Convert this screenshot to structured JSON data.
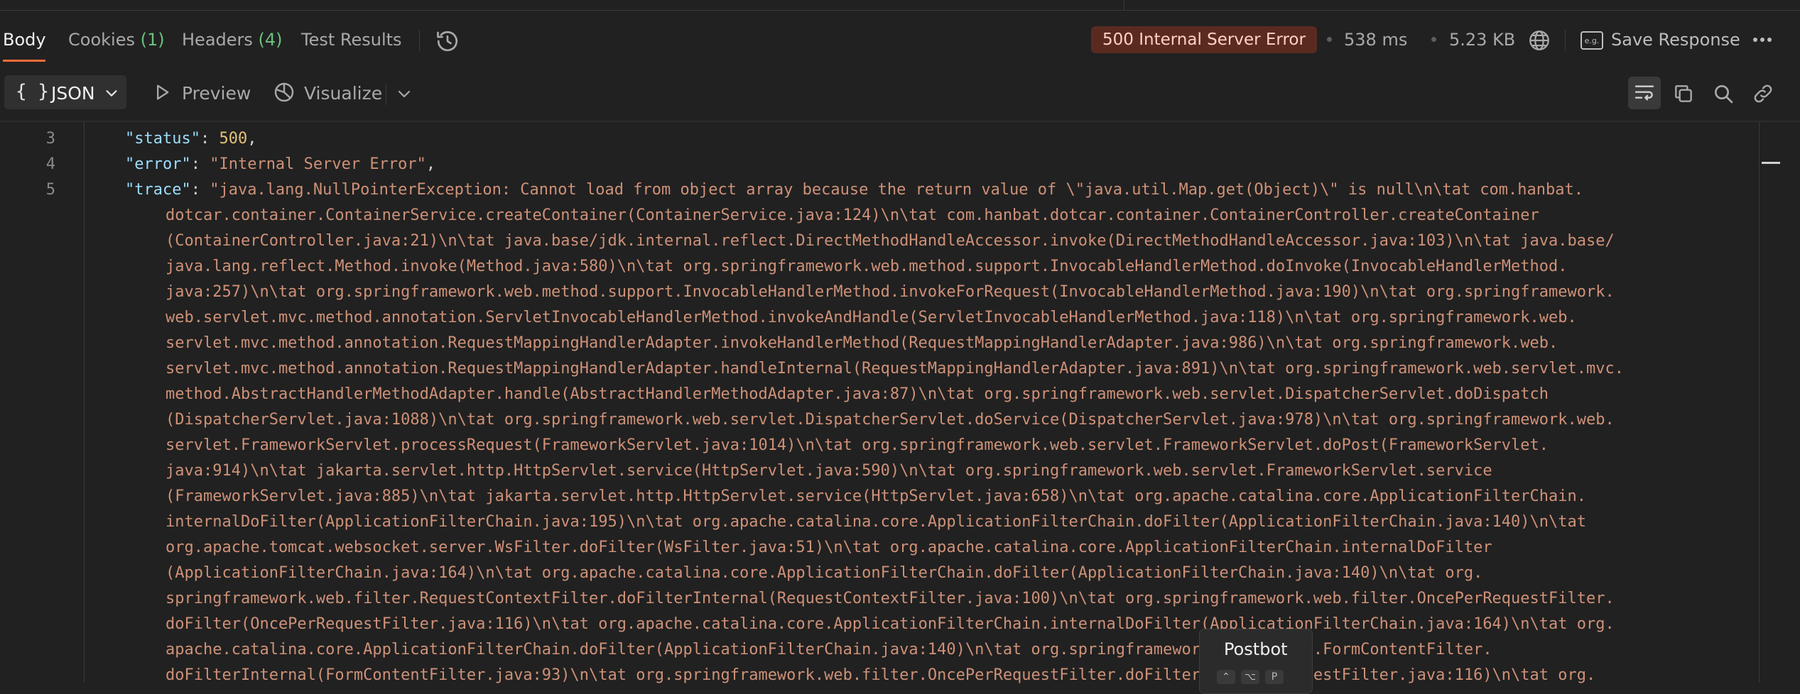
{
  "tabs": [
    {
      "label": "Body",
      "count": ""
    },
    {
      "label": "Cookies",
      "count": "(1)"
    },
    {
      "label": "Headers",
      "count": "(4)"
    },
    {
      "label": "Test Results",
      "count": ""
    }
  ],
  "response_meta": {
    "status": "500 Internal Server Error",
    "time": "538 ms",
    "size": "5.23 KB",
    "save_label": "Save Response",
    "eg_icon_text": "e.g."
  },
  "toolbar": {
    "format_braces": "{ }",
    "format_label": "JSON",
    "preview_label": "Preview",
    "visualize_label": "Visualize"
  },
  "code": {
    "lines": [
      {
        "number": "3",
        "key": "\"status\"",
        "value": "500",
        "trail": ","
      },
      {
        "number": "4",
        "key": "\"error\"",
        "value": "\"Internal Server Error\"",
        "trail": ","
      },
      {
        "number": "5",
        "key": "\"trace\"",
        "value": "\"java.lang.NullPointerException: Cannot load from object array because the return value of \\\"java.util.Map.get(Object)\\\" is null\\n\\tat com.hanbat.",
        "trail": ""
      }
    ],
    "trace_continuation": [
      "dotcar.container.ContainerService.createContainer(ContainerService.java:124)\\n\\tat com.hanbat.dotcar.container.ContainerController.createContainer",
      "(ContainerController.java:21)\\n\\tat java.base/jdk.internal.reflect.DirectMethodHandleAccessor.invoke(DirectMethodHandleAccessor.java:103)\\n\\tat java.base/",
      "java.lang.reflect.Method.invoke(Method.java:580)\\n\\tat org.springframework.web.method.support.InvocableHandlerMethod.doInvoke(InvocableHandlerMethod.",
      "java:257)\\n\\tat org.springframework.web.method.support.InvocableHandlerMethod.invokeForRequest(InvocableHandlerMethod.java:190)\\n\\tat org.springframework.",
      "web.servlet.mvc.method.annotation.ServletInvocableHandlerMethod.invokeAndHandle(ServletInvocableHandlerMethod.java:118)\\n\\tat org.springframework.web.",
      "servlet.mvc.method.annotation.RequestMappingHandlerAdapter.invokeHandlerMethod(RequestMappingHandlerAdapter.java:986)\\n\\tat org.springframework.web.",
      "servlet.mvc.method.annotation.RequestMappingHandlerAdapter.handleInternal(RequestMappingHandlerAdapter.java:891)\\n\\tat org.springframework.web.servlet.mvc.",
      "method.AbstractHandlerMethodAdapter.handle(AbstractHandlerMethodAdapter.java:87)\\n\\tat org.springframework.web.servlet.DispatcherServlet.doDispatch",
      "(DispatcherServlet.java:1088)\\n\\tat org.springframework.web.servlet.DispatcherServlet.doService(DispatcherServlet.java:978)\\n\\tat org.springframework.web.",
      "servlet.FrameworkServlet.processRequest(FrameworkServlet.java:1014)\\n\\tat org.springframework.web.servlet.FrameworkServlet.doPost(FrameworkServlet.",
      "java:914)\\n\\tat jakarta.servlet.http.HttpServlet.service(HttpServlet.java:590)\\n\\tat org.springframework.web.servlet.FrameworkServlet.service",
      "(FrameworkServlet.java:885)\\n\\tat jakarta.servlet.http.HttpServlet.service(HttpServlet.java:658)\\n\\tat org.apache.catalina.core.ApplicationFilterChain.",
      "internalDoFilter(ApplicationFilterChain.java:195)\\n\\tat org.apache.catalina.core.ApplicationFilterChain.doFilter(ApplicationFilterChain.java:140)\\n\\tat",
      "org.apache.tomcat.websocket.server.WsFilter.doFilter(WsFilter.java:51)\\n\\tat org.apache.catalina.core.ApplicationFilterChain.internalDoFilter",
      "(ApplicationFilterChain.java:164)\\n\\tat org.apache.catalina.core.ApplicationFilterChain.doFilter(ApplicationFilterChain.java:140)\\n\\tat org.",
      "springframework.web.filter.RequestContextFilter.doFilterInternal(RequestContextFilter.java:100)\\n\\tat org.springframework.web.filter.OncePerRequestFilter.",
      "doFilter(OncePerRequestFilter.java:116)\\n\\tat org.apache.catalina.core.ApplicationFilterChain.internalDoFilter(ApplicationFilterChain.java:164)\\n\\tat org.",
      "apache.catalina.core.ApplicationFilterChain.doFilter(ApplicationFilterChain.java:140)\\n\\tat org.springframework.web.filter.FormContentFilter.",
      "doFilterInternal(FormContentFilter.java:93)\\n\\tat org.springframework.web.filter.OncePerRequestFilter.doFilter(OncePerRequestFilter.java:116)\\n\\tat org."
    ]
  },
  "postbot": {
    "title": "Postbot",
    "keys": [
      "⌃",
      "⌥",
      "P"
    ]
  },
  "colors": {
    "accent": "#ff6c37",
    "status_bg": "#5a2a20",
    "string": "#ce9178",
    "key": "#9cdcfe"
  }
}
